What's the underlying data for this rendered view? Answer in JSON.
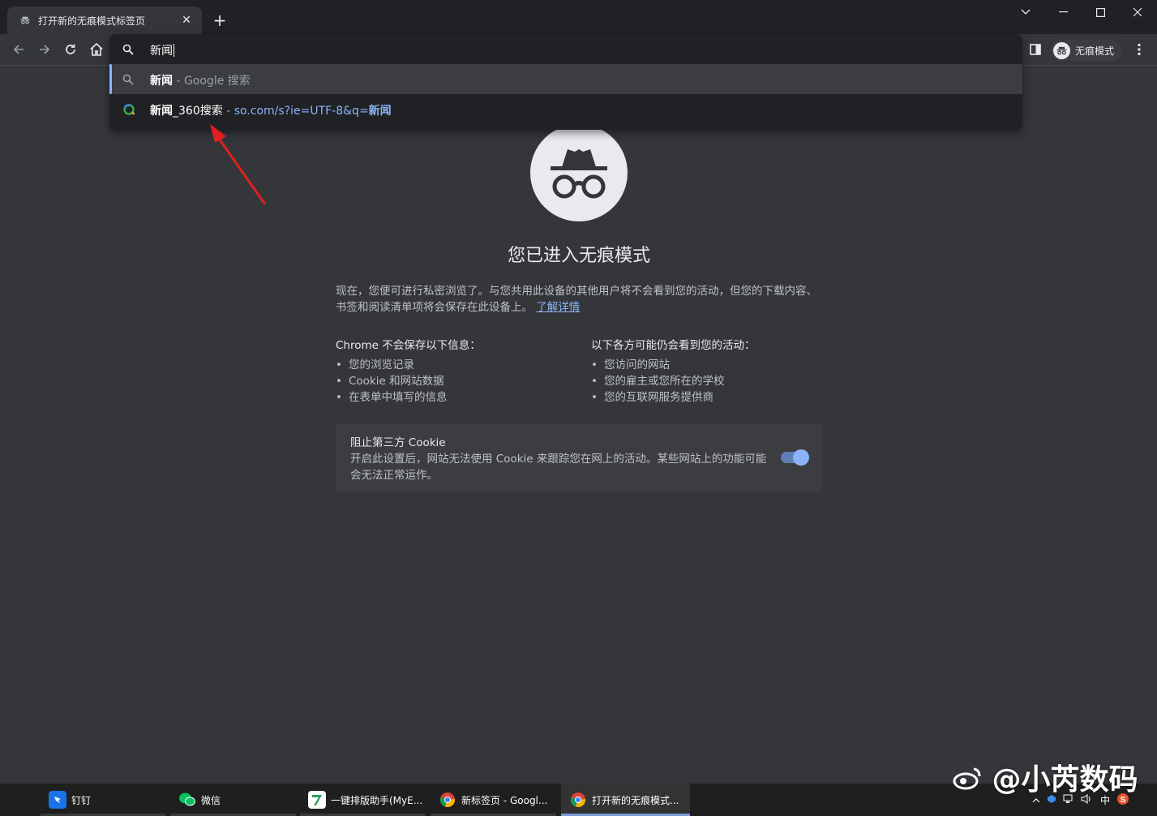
{
  "tab": {
    "title": "打开新的无痕模式标签页"
  },
  "omnibox": {
    "typed": "新闻",
    "suggestions": [
      {
        "bold": "新闻",
        "sep": " - ",
        "rest": "Google 搜索"
      },
      {
        "bold": "新闻",
        "mid": "_360搜索",
        "sep": " - ",
        "url_prefix": "so.com/s?ie=UTF-8&q=",
        "url_bold": "新闻"
      }
    ]
  },
  "profile": {
    "label": "无痕模式"
  },
  "content": {
    "heading": "您已进入无痕模式",
    "intro": "现在，您便可进行私密浏览了。与您共用此设备的其他用户将不会看到您的活动，但您的下载内容、书签和阅读清单项将会保存在此设备上。",
    "learn_more": "了解详情",
    "left_col": {
      "title": "Chrome 不会保存以下信息：",
      "items": [
        "您的浏览记录",
        "Cookie 和网站数据",
        "在表单中填写的信息"
      ]
    },
    "right_col": {
      "title": "以下各方可能仍会看到您的活动：",
      "items": [
        "您访问的网站",
        "您的雇主或您所在的学校",
        "您的互联网服务提供商"
      ]
    },
    "cookie": {
      "title": "阻止第三方 Cookie",
      "desc": "开启此设置后，网站无法使用 Cookie 来跟踪您在网上的活动。某些网站上的功能可能会无法正常运作。",
      "enabled": true
    }
  },
  "taskbar": {
    "items": [
      {
        "label": "钉钉",
        "color": "#1a73e8"
      },
      {
        "label": "微信",
        "color": "#07c160"
      },
      {
        "label": "一键排版助手(MyE...",
        "color": "#2e9d5e"
      },
      {
        "label": "新标签页 - Googl...",
        "color": "#4285f4"
      },
      {
        "label": "打开新的无痕模式...",
        "color": "#4285f4"
      }
    ],
    "tray": {
      "ime": "中"
    }
  },
  "watermark": "@小芮数码",
  "colors": {
    "accent": "#8ab4f8",
    "arrow": "#e02020"
  }
}
